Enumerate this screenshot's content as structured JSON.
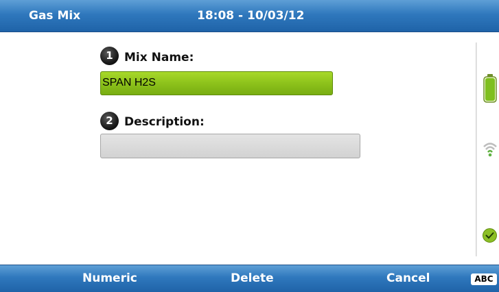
{
  "header": {
    "title": "Gas Mix",
    "datetime": "18:08 - 10/03/12",
    "colors": {
      "bar_top": "#5e9fd6",
      "bar_bottom": "#1f63a8"
    }
  },
  "form": {
    "fields": [
      {
        "step": "1",
        "label": "Mix Name:",
        "value": "SPAN H2S",
        "state": "active",
        "color": "#8dc21b"
      },
      {
        "step": "2",
        "label": "Description:",
        "value": "",
        "state": "inactive",
        "color": "#d8d8d8"
      }
    ]
  },
  "status_icons": [
    {
      "icon": "battery-icon",
      "level": 1.0,
      "color": "#7fbf1f"
    },
    {
      "icon": "wireless-signal-icon"
    },
    {
      "icon": "checkmark-icon",
      "color": "#8cbf26"
    }
  ],
  "softkeys": {
    "left": "Numeric",
    "middle": "Delete",
    "right": "Cancel",
    "mode": "ABC"
  }
}
